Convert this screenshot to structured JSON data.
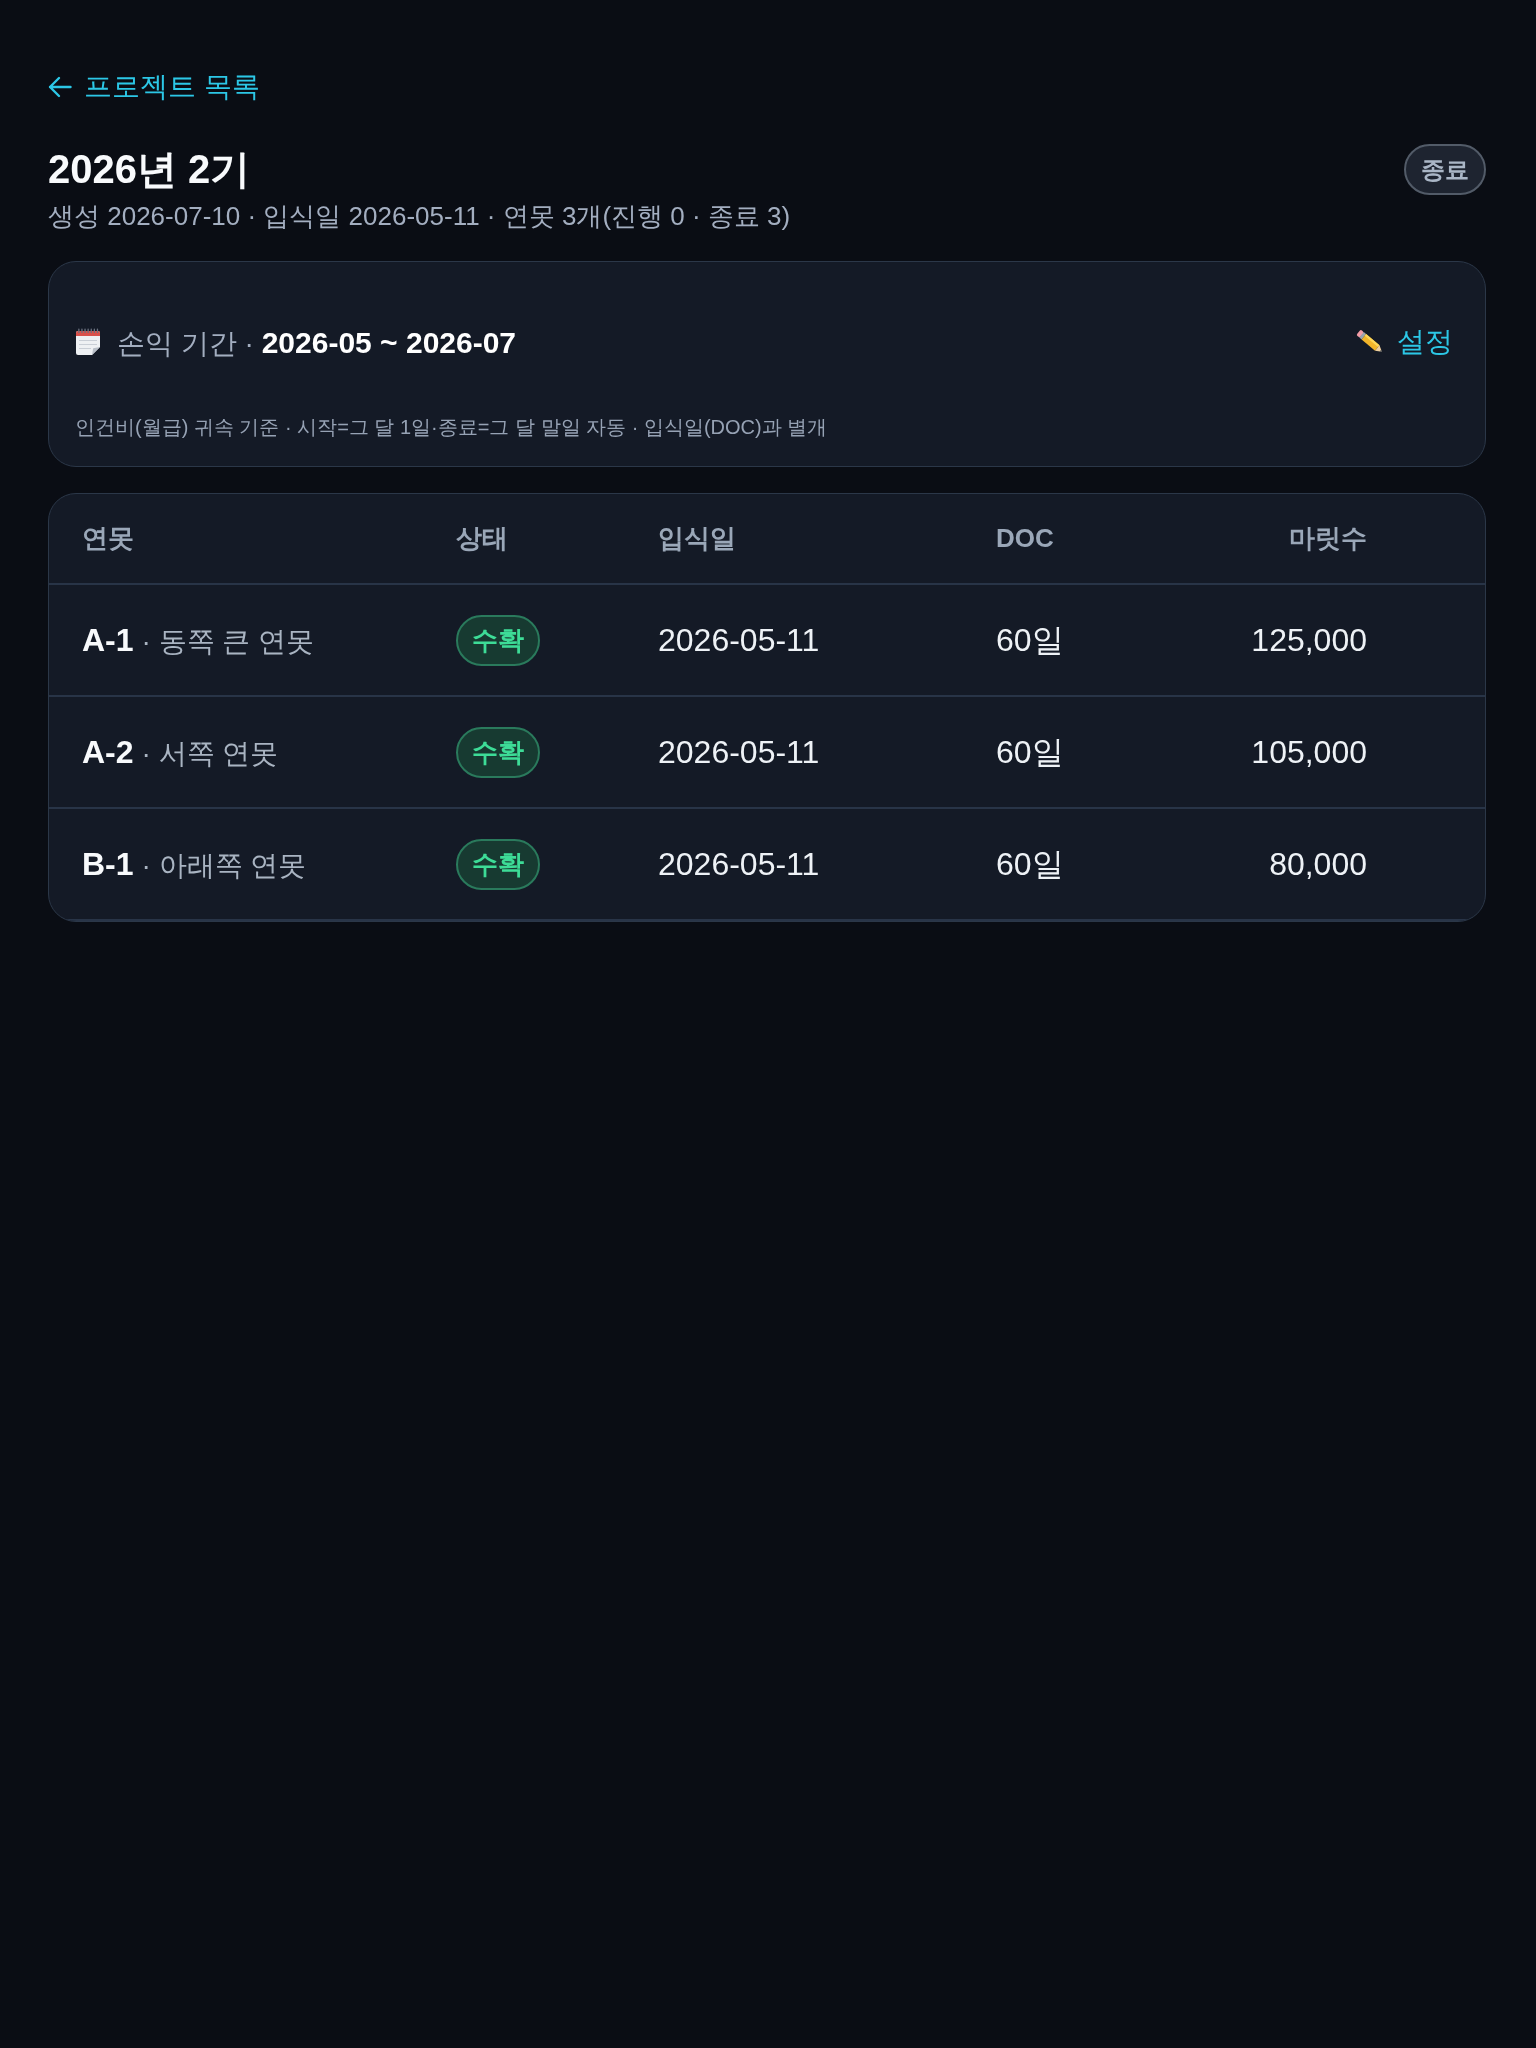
{
  "back_link": {
    "label": "프로젝트 목록"
  },
  "header": {
    "title": "2026년 2기",
    "subtitle": "생성 2026-07-10 · 입식일 2026-05-11 · 연못 3개(진행 0 · 종료 3)",
    "status": "종료"
  },
  "period_card": {
    "label": "손익 기간 · **2026-05 ~ 2026-07**",
    "edit_button": "설정",
    "note": "인건비(월급) 귀속 기준 · 시작=그 달 1일·종료=그 달 말일 자동 · 입식일(DOC)과 별개"
  },
  "table": {
    "columns": [
      "연못",
      "상태",
      "입식일",
      "DOC",
      "마릿수"
    ],
    "rows": [
      {
        "code": "A-1",
        "name": "· 동쪽 큰 연못",
        "status": "수확",
        "stock_date": "2026-05-11",
        "doc": "60일",
        "count": "125,000"
      },
      {
        "code": "A-2",
        "name": "· 서쪽 연못",
        "status": "수확",
        "stock_date": "2026-05-11",
        "doc": "60일",
        "count": "105,000"
      },
      {
        "code": "B-1",
        "name": "· 아래쪽 연못",
        "status": "수확",
        "stock_date": "2026-05-11",
        "doc": "60일",
        "count": "80,000"
      }
    ]
  }
}
